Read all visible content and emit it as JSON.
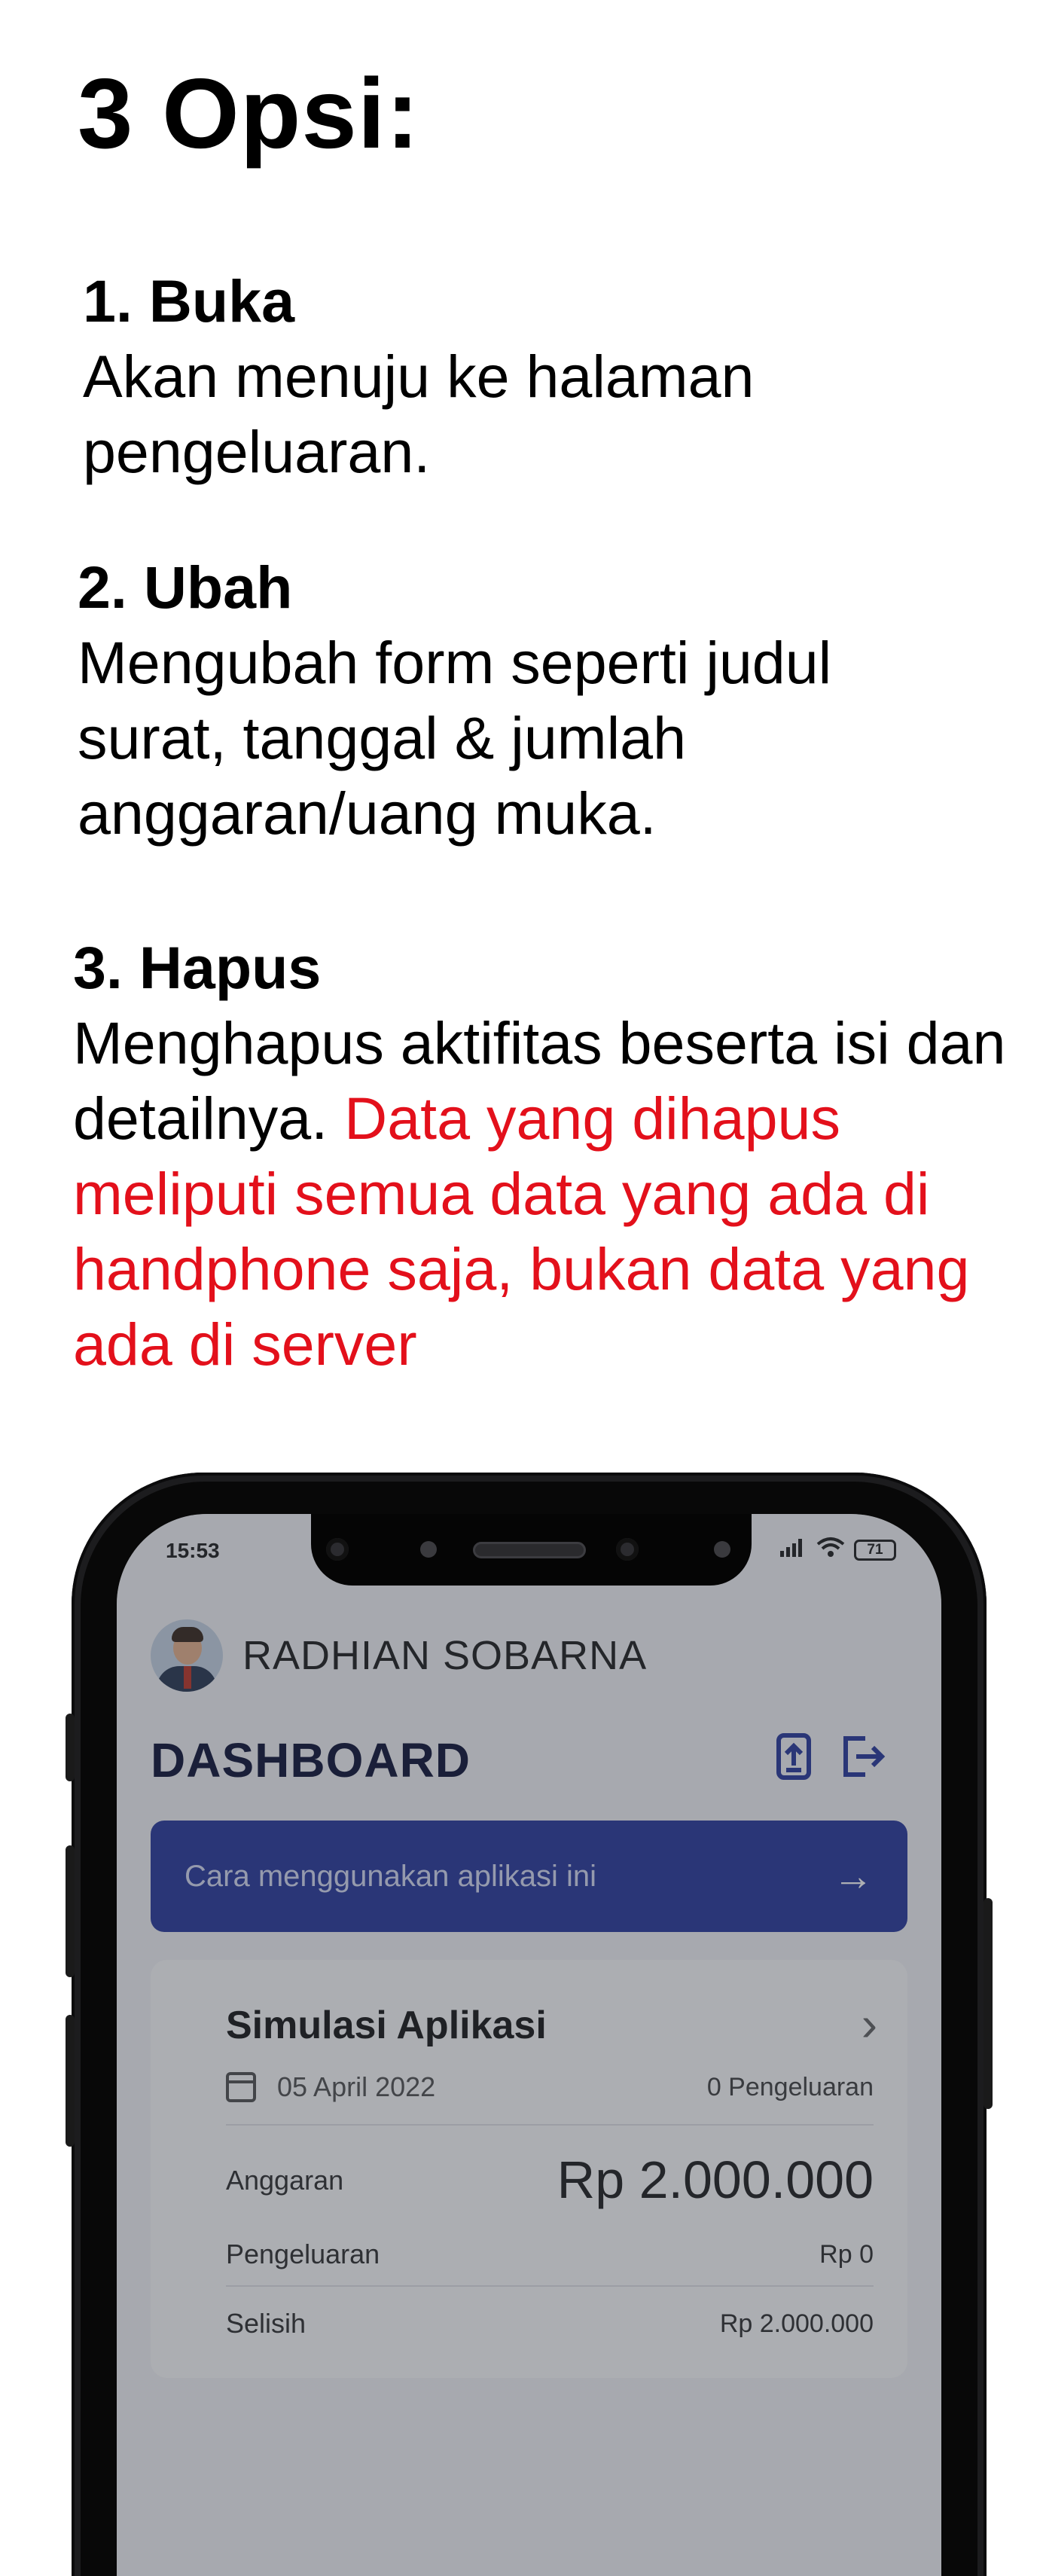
{
  "doc": {
    "title": "3 Opsi:",
    "options": [
      {
        "head": "1. Buka",
        "body": "Akan menuju ke halaman pengeluaran."
      },
      {
        "head": "2. Ubah",
        "body": "Mengubah form seperti judul surat, tanggal & jumlah anggaran/uang muka."
      },
      {
        "head": "3. Hapus",
        "body": "Menghapus aktifitas beserta isi dan detailnya.",
        "warning": "Data yang dihapus meliputi semua data yang ada di handphone saja, bukan data yang ada di server"
      }
    ]
  },
  "status_bar": {
    "time": "15:53",
    "battery": "71"
  },
  "app": {
    "user_name": "RADHIAN SOBARNA",
    "page_title": "DASHBOARD",
    "help_label": "Cara menggunakan aplikasi ini",
    "card": {
      "title": "Simulasi Aplikasi",
      "date": "05 April 2022",
      "count": "0 Pengeluaran",
      "anggaran_label": "Anggaran",
      "anggaran_value": "Rp 2.000.000",
      "pengeluaran_label": "Pengeluaran",
      "pengeluaran_value": "Rp 0",
      "selisih_label": "Selisih",
      "selisih_value": "Rp 2.000.000"
    }
  },
  "colors": {
    "accent": "#2c3d9e",
    "warning": "#e3101b"
  }
}
